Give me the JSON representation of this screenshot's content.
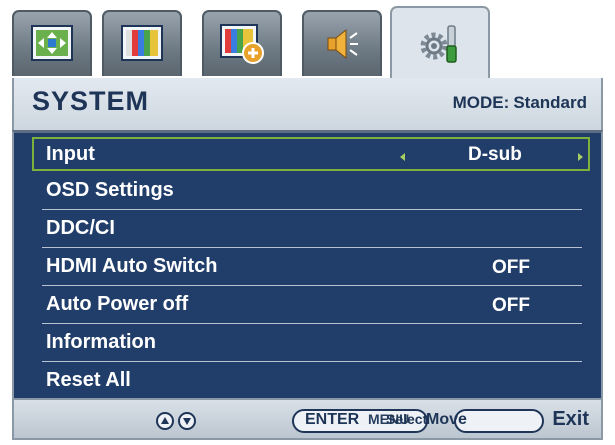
{
  "tabs": [
    {
      "icon": "picture-adjust-icon"
    },
    {
      "icon": "color-bars-icon"
    },
    {
      "icon": "picture-advanced-icon"
    },
    {
      "icon": "speaker-volume-icon"
    },
    {
      "icon": "system-gear-wrench-icon",
      "active": true
    }
  ],
  "header": {
    "title": "SYSTEM",
    "mode_label": "MODE:",
    "mode_value": "Standard"
  },
  "menu": {
    "items": [
      {
        "label": "Input",
        "value": "D-sub",
        "selected": true
      },
      {
        "label": "OSD Settings",
        "value": ""
      },
      {
        "label": "DDC/CI",
        "value": ""
      },
      {
        "label": "HDMI Auto Switch",
        "value": "OFF"
      },
      {
        "label": "Auto Power off",
        "value": "OFF"
      },
      {
        "label": "Information",
        "value": ""
      },
      {
        "label": "Reset All",
        "value": ""
      }
    ]
  },
  "footer": {
    "move_label": "Move",
    "enter_label": "ENTER",
    "select_label": "Select",
    "menu_label": "MENU",
    "exit_label": "Exit"
  },
  "colors": {
    "menu_bg": "#213e6a",
    "text_dark": "#1e3557",
    "selection_border": "#7cb23a",
    "arrow": "#a6ce63"
  }
}
